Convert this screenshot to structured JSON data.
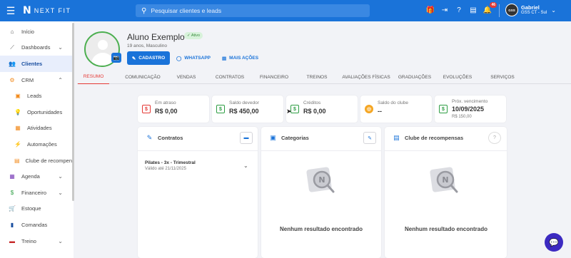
{
  "topbar": {
    "menu_icon": "menu-icon",
    "brand": "NEXT FIT",
    "search_placeholder": "Pesquisar clientes e leads",
    "notification_count": "46",
    "user_name": "Gabriel",
    "user_unit": "GSS CT - Sul",
    "avatar_text": "GSS"
  },
  "sidebar": {
    "items": [
      {
        "label": "Início",
        "icon": "home-icon"
      },
      {
        "label": "Dashboards",
        "icon": "chart-icon"
      },
      {
        "label": "Clientes",
        "icon": "people-icon"
      },
      {
        "label": "CRM",
        "icon": "crm-icon"
      },
      {
        "label": "Leads",
        "icon": "leads-icon"
      },
      {
        "label": "Oportunidades",
        "icon": "lightbulb-icon"
      },
      {
        "label": "Atividades",
        "icon": "calendar-check-icon"
      },
      {
        "label": "Automações",
        "icon": "automation-icon"
      },
      {
        "label": "Clube de recompensas",
        "icon": "reward-icon"
      },
      {
        "label": "Agenda",
        "icon": "calendar-icon"
      },
      {
        "label": "Financeiro",
        "icon": "money-icon"
      },
      {
        "label": "Estoque",
        "icon": "cart-icon"
      },
      {
        "label": "Comandas",
        "icon": "receipt-icon"
      },
      {
        "label": "Treino",
        "icon": "dumbbell-icon"
      }
    ]
  },
  "profile": {
    "name": "Aluno Exemplo",
    "status": "Ativo",
    "subtitle": "19 anos, Masculino",
    "btn_cadastro": "CADASTRO",
    "btn_whatsapp": "WHATSAPP",
    "btn_more": "MAIS AÇÕES"
  },
  "tabs": [
    "RESUMO",
    "COMUNICAÇÃO",
    "VENDAS",
    "CONTRATOS",
    "FINANCEIRO",
    "TREINOS",
    "AVALIAÇÕES FÍSICAS",
    "GRADUAÇÕES",
    "EVOLUÇÕES",
    "SERVIÇOS"
  ],
  "stats": [
    {
      "label": "Em atraso",
      "value": "R$ 0,00",
      "color": "#e53935"
    },
    {
      "label": "Saldo devedor",
      "value": "R$ 450,00",
      "color": "#2e9e44"
    },
    {
      "label": "Créditos",
      "value": "R$ 0,00",
      "color": "#2e9e44"
    },
    {
      "label": "Saldo do clube",
      "value": "--",
      "color": "#f5a623"
    },
    {
      "label": "Próx. vencimento",
      "value": "10/09/2025",
      "extra": "R$ 150,00",
      "color": "#2e9e44"
    }
  ],
  "panels": {
    "contratos": {
      "title": "Contratos",
      "contract_name": "Pilates - 3x - Trimestral",
      "contract_valid": "Válido até 21/11/2025"
    },
    "categorias": {
      "title": "Categorias",
      "empty": "Nenhum resultado encontrado"
    },
    "clube": {
      "title": "Clube de recompensas",
      "empty": "Nenhum resultado encontrado"
    }
  },
  "colors": {
    "primary": "#1a73d9",
    "active_tab": "#e53935",
    "chat": "#3c2ac1"
  }
}
